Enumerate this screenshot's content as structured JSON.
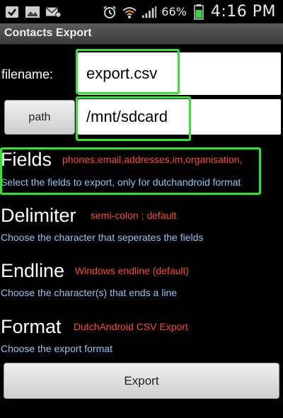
{
  "status_bar": {
    "battery": "66%",
    "time": "4:16 PM",
    "icons": [
      "check-icon",
      "image-icon",
      "gmail-icon",
      "alarm-icon",
      "wifi-icon",
      "signal-icon",
      "battery-icon"
    ]
  },
  "app": {
    "title": "Contacts Export"
  },
  "filename": {
    "label": "filename:",
    "value": "export.csv"
  },
  "path": {
    "button_label": "path",
    "value": "/mnt/sdcard"
  },
  "settings": [
    {
      "title": "Fields",
      "value": "phones,email,addresses,im,organisation,",
      "description": "Select the fields to export, only for dutchandroid format"
    },
    {
      "title": "Delimiter",
      "value": "semi-colon ; default",
      "description": "Choose the character that seperates the fields"
    },
    {
      "title": "Endline",
      "value": "Windows endline (default)",
      "description": "Choose the character(s) that ends a line"
    },
    {
      "title": "Format",
      "value": "DutchAndroid CSV Export",
      "description": "Choose the export format"
    }
  ],
  "export_button": {
    "label": "Export"
  },
  "colors": {
    "highlight": "#2ee62e",
    "value_text": "#ff4a2a",
    "description_text": "#8fc6f2"
  }
}
